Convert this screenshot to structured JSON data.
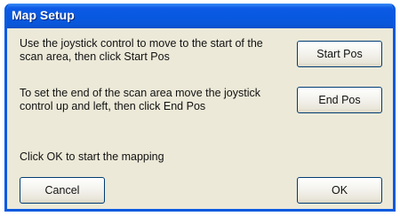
{
  "window": {
    "title": "Map Setup"
  },
  "instructions": {
    "start": "Use the joystick control to move to the start of the scan area, then click Start Pos",
    "end": "To set the end of the scan area move the joystick control up and left, then click End Pos",
    "ok": "Click OK to start the mapping"
  },
  "buttons": {
    "start_pos": "Start Pos",
    "end_pos": "End Pos",
    "cancel": "Cancel",
    "ok": "OK"
  },
  "colors": {
    "titlebar": "#0858E0",
    "dialog_background": "#ECE9D8",
    "button_border": "#003C74"
  }
}
